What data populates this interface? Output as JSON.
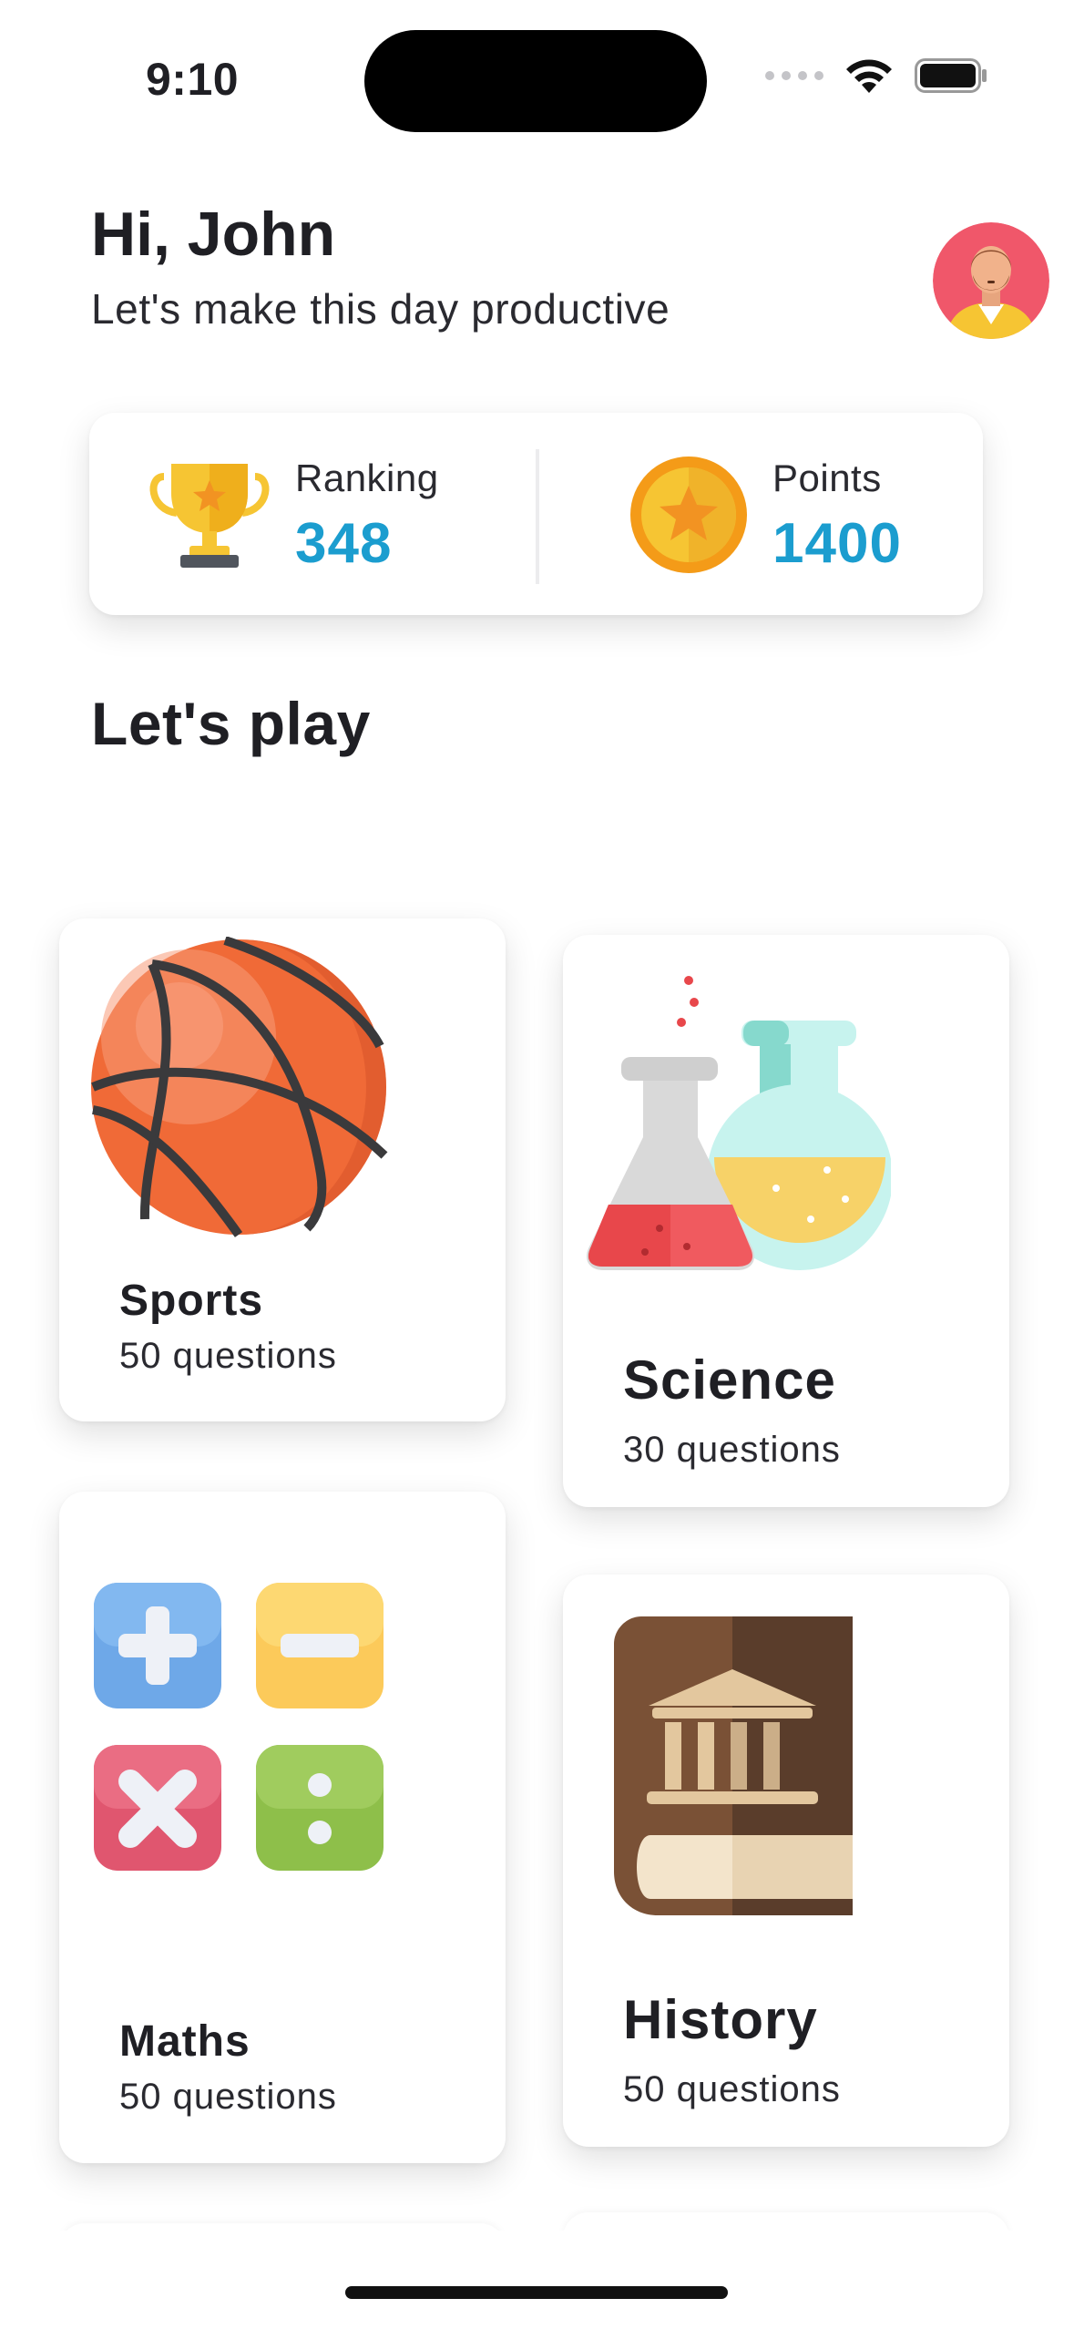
{
  "status_bar": {
    "time": "9:10"
  },
  "header": {
    "greeting": "Hi, John",
    "subtitle": "Let's make this day productive"
  },
  "stats": {
    "ranking_label": "Ranking",
    "ranking_value": "348",
    "points_label": "Points",
    "points_value": "1400"
  },
  "section": {
    "title": "Let's play"
  },
  "categories": [
    {
      "title": "Sports",
      "subtitle": "50 questions",
      "icon": "basketball-icon"
    },
    {
      "title": "Science",
      "subtitle": "30 questions",
      "icon": "flasks-icon"
    },
    {
      "title": "Maths",
      "subtitle": "50 questions",
      "icon": "math-operators-icon"
    },
    {
      "title": "History",
      "subtitle": "50 questions",
      "icon": "history-book-icon"
    }
  ],
  "colors": {
    "accent": "#1b9dcf",
    "text": "#1f1f24",
    "background": "#ffffff"
  }
}
